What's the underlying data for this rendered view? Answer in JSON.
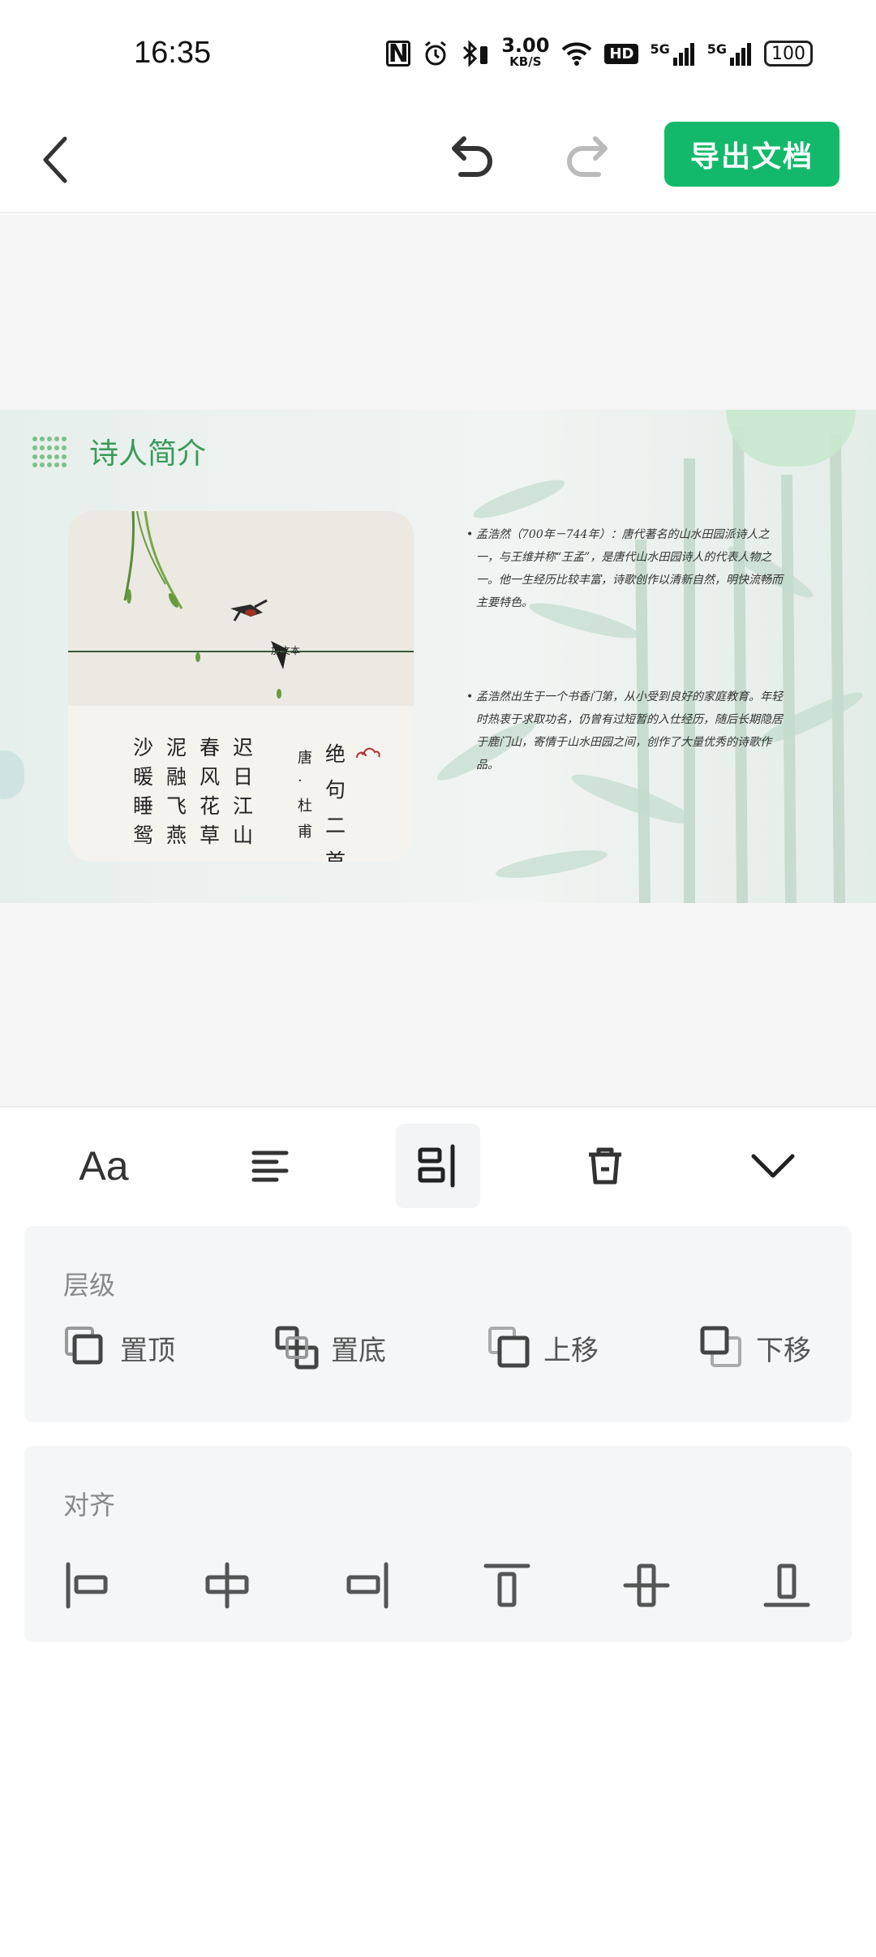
{
  "status_bar": {
    "time": "16:35",
    "nfc": "N",
    "speed_value": "3.00",
    "speed_unit": "KB/S",
    "hd": "HD",
    "signal1": "5G",
    "signal2": "5G",
    "battery": "100"
  },
  "toolbar": {
    "export_label": "导出文档"
  },
  "slide": {
    "title": "诗人简介",
    "poem_columns": [
      [
        "沙",
        "暖",
        "睡",
        "鸳"
      ],
      [
        "泥",
        "融",
        "飞",
        "燕"
      ],
      [
        "春",
        "风",
        "花",
        "草"
      ],
      [
        "迟",
        "日",
        "江",
        "山"
      ]
    ],
    "author": [
      "唐",
      "·",
      "杜",
      "甫"
    ],
    "poem_title": [
      "绝",
      "句",
      "二",
      "首"
    ],
    "watermark": "加文本",
    "bio_1": "孟浩然（700年－744年）：唐代著名的山水田园派诗人之一，与王维并称“王孟”，是唐代山水田园诗人的代表人物之一。他一生经历比较丰富，诗歌创作以清新自然，明快流畅而主要特色。",
    "bio_2": "孟浩然出生于一个书香门第，从小受到良好的家庭教育。年轻时热衷于求取功名，仍曾有过短暂的入仕经历，随后长期隐居于鹿门山，寄情于山水田园之间，创作了大量优秀的诗歌作品。"
  },
  "tabs": {
    "font_label": "Aa"
  },
  "layer_section": {
    "title": "层级",
    "items": [
      {
        "label": "置顶"
      },
      {
        "label": "置底"
      },
      {
        "label": "上移"
      },
      {
        "label": "下移"
      }
    ]
  },
  "align_section": {
    "title": "对齐"
  },
  "colors": {
    "accent": "#13b96a",
    "title_green": "#3a9a5a"
  }
}
